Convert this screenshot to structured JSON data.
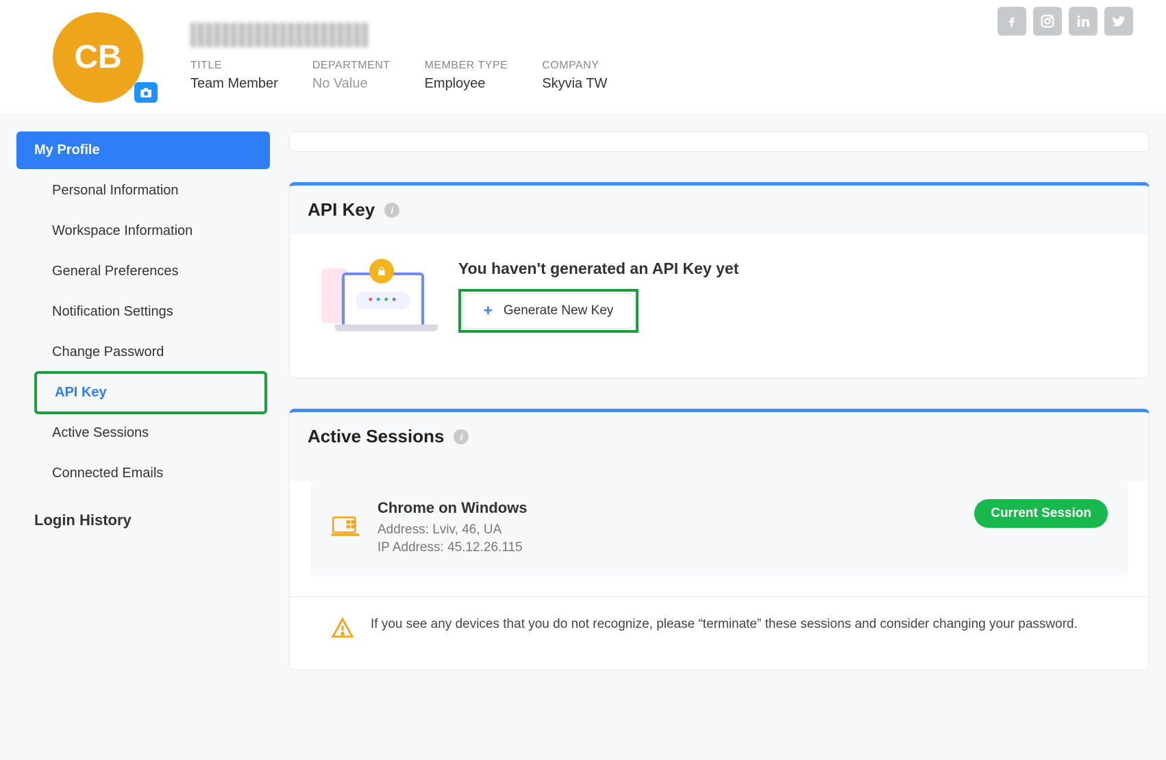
{
  "header": {
    "avatar_initials": "CB",
    "meta": {
      "title_label": "TITLE",
      "title_value": "Team Member",
      "dept_label": "DEPARTMENT",
      "dept_value": "No Value",
      "member_label": "MEMBER TYPE",
      "member_value": "Employee",
      "company_label": "COMPANY",
      "company_value": "Skyvia TW"
    }
  },
  "sidebar": {
    "items": [
      "My Profile",
      "Personal Information",
      "Workspace Information",
      "General Preferences",
      "Notification Settings",
      "Change Password",
      "API Key",
      "Active Sessions",
      "Connected Emails"
    ],
    "login_history": "Login History"
  },
  "api_key": {
    "heading": "API Key",
    "message": "You haven't generated an API Key yet",
    "button": "Generate New Key"
  },
  "sessions": {
    "heading": "Active Sessions",
    "item": {
      "device": "Chrome on Windows",
      "address_line": "Address: Lviv, 46, UA",
      "ip_line": "IP Address: 45.12.26.115",
      "badge": "Current Session"
    },
    "warning": "If you see any devices that you do not recognize, please “terminate” these sessions and consider changing your password."
  }
}
